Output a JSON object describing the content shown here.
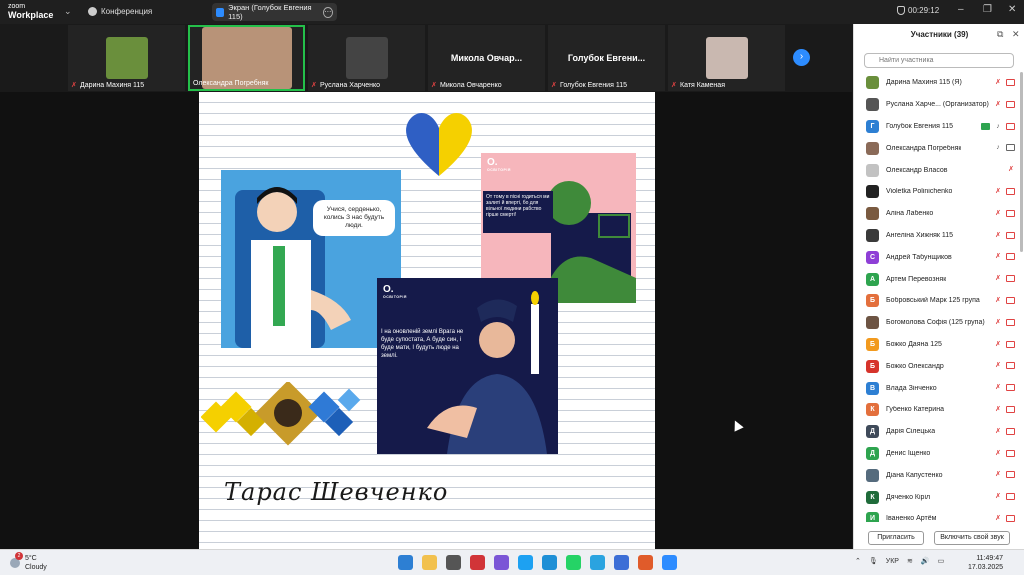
{
  "titlebar": {
    "logo_line1": "zoom",
    "logo_line2": "Workplace",
    "conference_label": "Конференция",
    "share_label": "Экран (Голубок Евгения 115)",
    "timer": "00:29:12"
  },
  "video_tiles": [
    {
      "name": "Дарина Махиня 115",
      "photo": "#6a8f3c"
    },
    {
      "name": "Олександра Погребняк",
      "photo": "#b89378"
    },
    {
      "name": "Руслана Харченко",
      "photo": "#444444"
    },
    {
      "name": "Микола Овчаренко",
      "big": "Микола Овчар..."
    },
    {
      "name": "Голубок Евгения 115",
      "big": "Голубок Евгени..."
    },
    {
      "name": "Катя Каменая",
      "photo": "#c9b8b0"
    }
  ],
  "slide": {
    "bubble_text": "Учися, серденько, колись З нас будуть люди.",
    "card2_quote": "От тому в пісні годиться ми залиті й вперті, бо для вільної людини рабство гірше смерті!",
    "card3_quote": "І на оновленій землі Врага не буде супостата, А буде син, і буде мати, І будуть люде на землі.",
    "brand_mark": "O.",
    "brand_name": "ОСВІТОРІЯ",
    "signature": "Тарас Шевченко",
    "colors": {
      "blue": "#4aa3df",
      "yellow": "#f5d000",
      "navy": "#151a4a",
      "pink": "#f6b6bc"
    }
  },
  "panel": {
    "title": "Участники (39)",
    "search_placeholder": "Найти участника",
    "invite_label": "Пригласить",
    "unmute_label": "Включить свой звук",
    "participants": [
      {
        "name": "Дарина Махиня 115 (Я)",
        "avatar": "",
        "color": "#6a8f3c",
        "mic": "off",
        "cam": "off"
      },
      {
        "name": "Руслана Харче... (Организатор)",
        "avatar": "",
        "color": "#555555",
        "mic": "off",
        "cam": "off"
      },
      {
        "name": "Голубок Евгения 115",
        "avatar": "Г",
        "color": "#2d7fd3",
        "mic": "on",
        "cam": "off",
        "screen": "on"
      },
      {
        "name": "Олександра Погребняк",
        "avatar": "",
        "color": "#8a6a58",
        "mic": "on",
        "cam": "on"
      },
      {
        "name": "Олександр Власов",
        "avatar": "",
        "color": "#c2c2c2",
        "mic": "off",
        "cam": "none"
      },
      {
        "name": "Violetka Polinichenko",
        "avatar": "",
        "color": "#222222",
        "mic": "off",
        "cam": "off"
      },
      {
        "name": "Аліна Лабенко",
        "avatar": "",
        "color": "#7a5a40",
        "mic": "off",
        "cam": "off"
      },
      {
        "name": "Ангеліна Хижняк 115",
        "avatar": "",
        "color": "#3a3a3a",
        "mic": "off",
        "cam": "off"
      },
      {
        "name": "Андрей Табунщиков",
        "avatar": "С",
        "color": "#8e3fd6",
        "mic": "off",
        "cam": "off"
      },
      {
        "name": "Артем Перевозняк",
        "avatar": "А",
        "color": "#2ea44f",
        "mic": "off",
        "cam": "off"
      },
      {
        "name": "Бобровський Марк 125 група",
        "avatar": "Б",
        "color": "#e36f3c",
        "mic": "off",
        "cam": "off"
      },
      {
        "name": "Богомолова Софія (125 група)",
        "avatar": "",
        "color": "#6d5443",
        "mic": "off",
        "cam": "off"
      },
      {
        "name": "Божко Даяна 125",
        "avatar": "Б",
        "color": "#f29a1e",
        "mic": "off",
        "cam": "off"
      },
      {
        "name": "Божко Олександр",
        "avatar": "Б",
        "color": "#d6332b",
        "mic": "off",
        "cam": "off"
      },
      {
        "name": "Влада Зінченко",
        "avatar": "В",
        "color": "#2d7fd3",
        "mic": "off",
        "cam": "off"
      },
      {
        "name": "Губенко Катерина",
        "avatar": "К",
        "color": "#e36f3c",
        "mic": "off",
        "cam": "off"
      },
      {
        "name": "Дарія Сілецька",
        "avatar": "Д",
        "color": "#3f4a5a",
        "mic": "off",
        "cam": "off"
      },
      {
        "name": "Денис Іщенко",
        "avatar": "Д",
        "color": "#2ea44f",
        "mic": "off",
        "cam": "off"
      },
      {
        "name": "Діана Капустенко",
        "avatar": "",
        "color": "#556b7d",
        "mic": "off",
        "cam": "off"
      },
      {
        "name": "Дяченко Кіріл",
        "avatar": "К",
        "color": "#1f6b3a",
        "mic": "off",
        "cam": "off"
      },
      {
        "name": "Іваненко Артём",
        "avatar": "И",
        "color": "#2ea44f",
        "mic": "off",
        "cam": "off"
      }
    ]
  },
  "taskbar": {
    "weather_temp": "5°C",
    "weather_desc": "Cloudy",
    "weather_badge": "2",
    "language": "УКР",
    "time": "11:49:47",
    "date": "17.03.2025",
    "app_colors": [
      "#2d7fd3",
      "#f2c14e",
      "#555555",
      "#d13438",
      "#7b56d6",
      "#1da1f2",
      "#1e8fd6",
      "#25d366",
      "#2aa3e0",
      "#3c6ed6",
      "#e05b2a",
      "#2d8cff"
    ]
  }
}
